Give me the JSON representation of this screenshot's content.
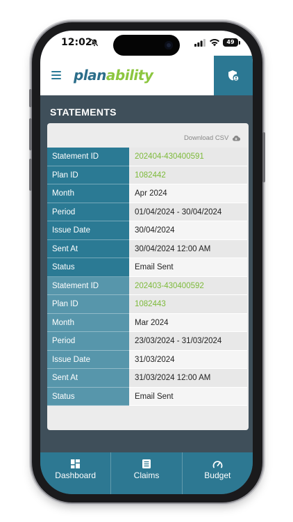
{
  "status_bar": {
    "time": "12:02",
    "battery": "49"
  },
  "header": {
    "logo_part1": "plan",
    "logo_part2": "ability"
  },
  "page": {
    "title": "STATEMENTS",
    "download_csv_label": "Download CSV"
  },
  "statements": [
    {
      "rows": [
        {
          "label": "Statement ID",
          "value": "202404-430400591"
        },
        {
          "label": "Plan ID",
          "value": "1082442"
        },
        {
          "label": "Month",
          "value": "Apr 2024"
        },
        {
          "label": "Period",
          "value": "01/04/2024 - 30/04/2024"
        },
        {
          "label": "Issue Date",
          "value": "30/04/2024"
        },
        {
          "label": "Sent At",
          "value": "30/04/2024 12:00 AM"
        },
        {
          "label": "Status",
          "value": "Email Sent"
        }
      ]
    },
    {
      "rows": [
        {
          "label": "Statement ID",
          "value": "202403-430400592"
        },
        {
          "label": "Plan ID",
          "value": "1082443"
        },
        {
          "label": "Month",
          "value": "Mar 2024"
        },
        {
          "label": "Period",
          "value": "23/03/2024 - 31/03/2024"
        },
        {
          "label": "Issue Date",
          "value": "31/03/2024"
        },
        {
          "label": "Sent At",
          "value": "31/03/2024 12:00 AM"
        },
        {
          "label": "Status",
          "value": "Email Sent"
        }
      ]
    }
  ],
  "bottom_nav": {
    "items": [
      {
        "label": "Dashboard",
        "icon": "dashboard-grid-icon"
      },
      {
        "label": "Claims",
        "icon": "claims-list-icon"
      },
      {
        "label": "Budget",
        "icon": "budget-gauge-icon"
      }
    ]
  },
  "colors": {
    "primary": "#2c7893",
    "label_dark": "#2b7a94",
    "label_light": "#5796ab",
    "link_green": "#7dba3a",
    "background": "#3f4f5a"
  }
}
